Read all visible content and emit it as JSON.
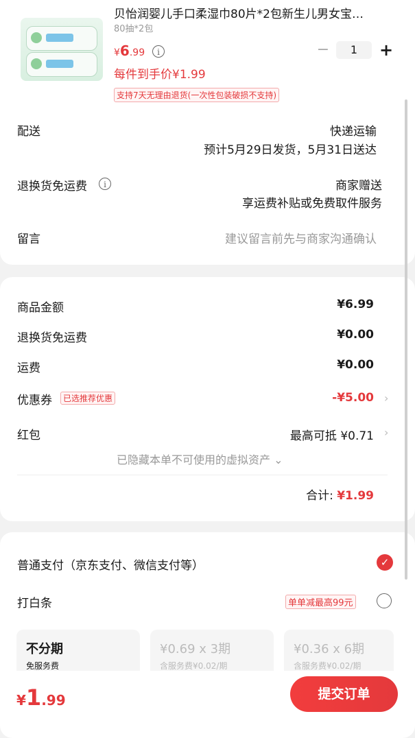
{
  "product": {
    "name": "贝怡润婴儿手口柔湿巾80片*2包新生儿男女宝…",
    "spec": "80抽*2包",
    "price_symbol": "¥",
    "price_int": "6",
    "price_dec": ".99",
    "daily_price": "每件到手价¥1.99",
    "return_tag": "支持7天无理由退货(一次性包装破损不支持)",
    "quantity": "1",
    "minus_label": "−",
    "plus_label": "+"
  },
  "shipping": {
    "label": "配送",
    "method": "快递运输",
    "estimate": "预计5月29日发货，5月31日送达",
    "return_label": "退换货免运费",
    "return_value": "商家赠送",
    "return_desc": "享运费补贴或免费取件服务",
    "message_label": "留言",
    "message_placeholder": "建议留言前先与商家沟通确认"
  },
  "summary": {
    "goods_label": "商品金额",
    "goods_value": "¥6.99",
    "return_label": "退换货免运费",
    "return_value": "¥0.00",
    "freight_label": "运费",
    "freight_value": "¥0.00",
    "coupon_label": "优惠券",
    "coupon_tag": "已选推荐优惠",
    "coupon_value": "-¥5.00",
    "redpack_label": "红包",
    "redpack_value": "最高可抵 ¥0.71",
    "hidden_note": "已隐藏本单不可使用的虚拟资产",
    "total_label": "合计:",
    "total_value": "¥1.99"
  },
  "payment": {
    "normal_label": "普通支付（京东支付、微信支付等）",
    "baitiao_label": "打白条",
    "baitiao_tag": "单单减最高99元",
    "plans": [
      {
        "title": "不分期",
        "sub": "免服务费"
      },
      {
        "title": "¥0.69 x 3期",
        "sub": "含服务费¥0.02/期"
      },
      {
        "title": "¥0.36 x 6期",
        "sub": "含服务费¥0.02/期"
      }
    ]
  },
  "footer": {
    "total_symbol": "¥",
    "total_int": "1",
    "total_dec": ".99",
    "submit_label": "提交订单"
  },
  "colors": {
    "accent": "#e4393c",
    "background": "#f2f2f2"
  },
  "icons": [
    "info-icon",
    "chevron-right-icon",
    "chevron-down-icon",
    "check-icon"
  ]
}
